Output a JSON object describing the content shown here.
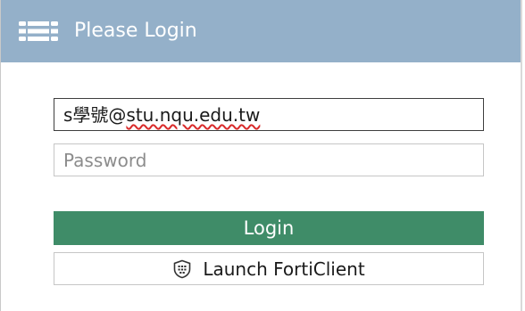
{
  "header": {
    "title": "Please Login",
    "logo_icon": "fortinet-logo-icon",
    "background": "#94b0c9"
  },
  "form": {
    "username_prefix": "s學號@",
    "username_suffix": "stu.nqu.edu.tw",
    "password_placeholder": "Password",
    "login_label": "Login",
    "login_color": "#3f8c68",
    "launch_label": "Launch FortiClient",
    "launch_icon": "forticlient-shield-icon"
  }
}
